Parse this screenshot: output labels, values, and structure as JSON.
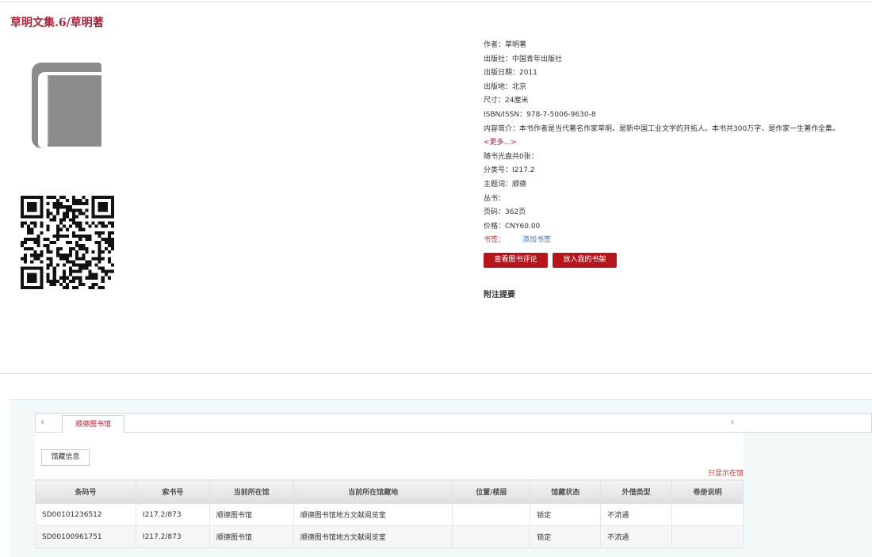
{
  "book": {
    "title": "草明文集.6/草明著"
  },
  "icons": {
    "cover": "book-icon",
    "qr": "qr-code-icon",
    "prev": "chevron-left-icon",
    "next": "chevron-right-icon"
  },
  "meta": {
    "author": "作者：草明著",
    "publisher": "出版社：中国青年出版社",
    "pub_date": "出版日期：2011",
    "pub_place": "出版地：北京",
    "size": "尺寸：24厘米",
    "isbn": "ISBN/ISSN：978-7-5006-9630-8",
    "summary": "内容简介：本书作者是当代著名作家草明，是新中国工业文学的开拓人。本书共300万字，是作家一生著作全集。",
    "more": "<更多...>",
    "disc": "随书光盘共0张：",
    "class_no": "分类号：I217.2",
    "subject": "主题词：顺德",
    "series": "丛书：",
    "pages": "页码：362页",
    "price": "价格：CNY60.00",
    "bookmark_label": "书签：",
    "add_bookmark": "添加书签"
  },
  "buttons": {
    "view_reviews": "查看图书评论",
    "add_to_shelf": "放入我的书架"
  },
  "notes_title": "附注提要",
  "holdings": {
    "library_tab": "顺德图书馆",
    "sub_tab": "馆藏信息",
    "only_loanable": "只显示在馆",
    "columns": [
      "条码号",
      "索书号",
      "当前所在馆",
      "当前所在馆藏地",
      "位置/楼层",
      "馆藏状态",
      "外借类型",
      "卷册说明"
    ],
    "rows": [
      [
        "SD00101236512",
        "I217.2/873",
        "顺德图书馆",
        "顺德图书馆地方文献阅览室",
        "",
        "锁定",
        "不流通",
        ""
      ],
      [
        "SD00100961751",
        "I217.2/873",
        "顺德图书馆",
        "顺德图书馆地方文献阅览室",
        "",
        "锁定",
        "不流通",
        ""
      ]
    ]
  },
  "colors": {
    "accent": "#a3263a",
    "button": "#b5161d",
    "link": "#3a73b8"
  }
}
